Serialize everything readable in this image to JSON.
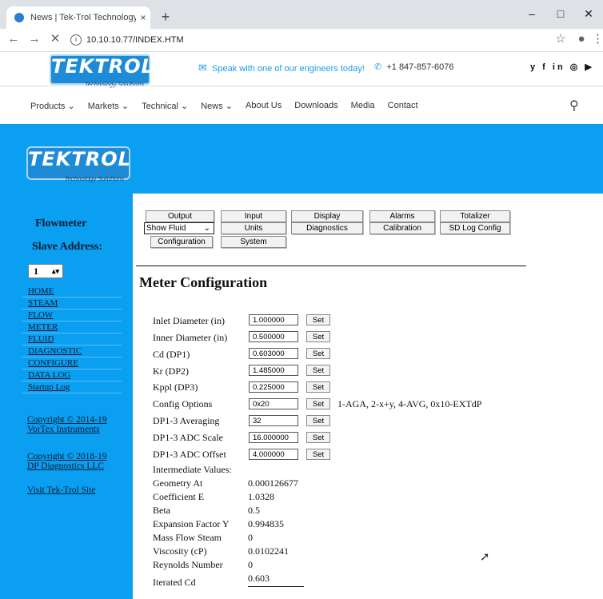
{
  "browser": {
    "tab_title": "News | Tek-Trol Technology Solut",
    "tab_close": "×",
    "new_tab": "+",
    "url": "10.10.10.77/INDEX.HTM",
    "win_min": "–",
    "win_max": "□",
    "win_close": "✕",
    "back": "←",
    "forward": "→",
    "stop": "✕",
    "star": "☆",
    "account": "●",
    "more": "⋮"
  },
  "site": {
    "logo_text": "TEKTROL",
    "logo_sub": "Technology Solutions",
    "speak_text": "Speak with one of our engineers today!",
    "phone": "+1 847-857-6076",
    "social": "y f in ◎ ▶",
    "menu": [
      "Products ⌄",
      "Markets ⌄",
      "Technical ⌄",
      "News ⌄",
      "About Us",
      "Downloads",
      "Media",
      "Contact"
    ],
    "search": "⚲"
  },
  "sidebar": {
    "title1": "Flowmeter",
    "title2": "Slave Address:",
    "slave_value": "1",
    "slave_arrows": "▴▾",
    "nav": [
      "HOME",
      "STEAM",
      "FLOW",
      "METER",
      "FLUID",
      "DIAGNOSTIC",
      "CONFIGURE",
      "DATA LOG",
      "Startup Log"
    ],
    "copyright1_line1": "Copyright © 2014-19",
    "copyright1_line2": "VorTex Instruments",
    "copyright2_line1": "Copyright © 2018-19",
    "copyright2_line2": "DP Diagnostics LLC",
    "visit": "Visit Tek-Trol Site"
  },
  "content": {
    "buttons_row1": [
      "Output",
      "Input",
      "Display",
      "Alarms",
      "Totalizer"
    ],
    "select_fluid": "Show Fluid",
    "buttons_row2": [
      "Units",
      "Diagnostics",
      "Calibration",
      "SD Log Config"
    ],
    "buttons_row3": [
      "Configuration",
      "System"
    ],
    "page_title": "Meter Configuration",
    "set_label": "Set",
    "fields": [
      {
        "label": "Inlet Diameter (in)",
        "value": "1.000000"
      },
      {
        "label": "Inner Diameter (in)",
        "value": "0.500000"
      },
      {
        "label": "Cd (DP1)",
        "value": "0.603000"
      },
      {
        "label": "Kr (DP2)",
        "value": "1.485000"
      },
      {
        "label": "Kppl (DP3)",
        "value": "0.225000"
      },
      {
        "label": "Config Options",
        "value": "0x20"
      },
      {
        "label": "DP1-3 Averaging",
        "value": "32"
      },
      {
        "label": "DP1-3 ADC Scale",
        "value": "16.000000"
      },
      {
        "label": "DP1-3 ADC Offset",
        "value": "4.000000"
      }
    ],
    "config_options_note": "1-AGA, 2-x+y, 4-AVG, 0x10-EXTdP",
    "intermediate_title": "Intermediate Values:",
    "intermediate": [
      {
        "label": "Geometry At",
        "value": "0.000126677"
      },
      {
        "label": "Coefficient E",
        "value": "1.0328"
      },
      {
        "label": "Beta",
        "value": "0.5"
      },
      {
        "label": "Expansion Factor Y",
        "value": "0.994835"
      },
      {
        "label": "Mass Flow Steam",
        "value": "0"
      },
      {
        "label": "Viscosity (cP)",
        "value": "0.0102241"
      },
      {
        "label": "Reynolds Number",
        "value": "0"
      },
      {
        "label": "Iterated Cd",
        "value": "0.603"
      }
    ]
  }
}
